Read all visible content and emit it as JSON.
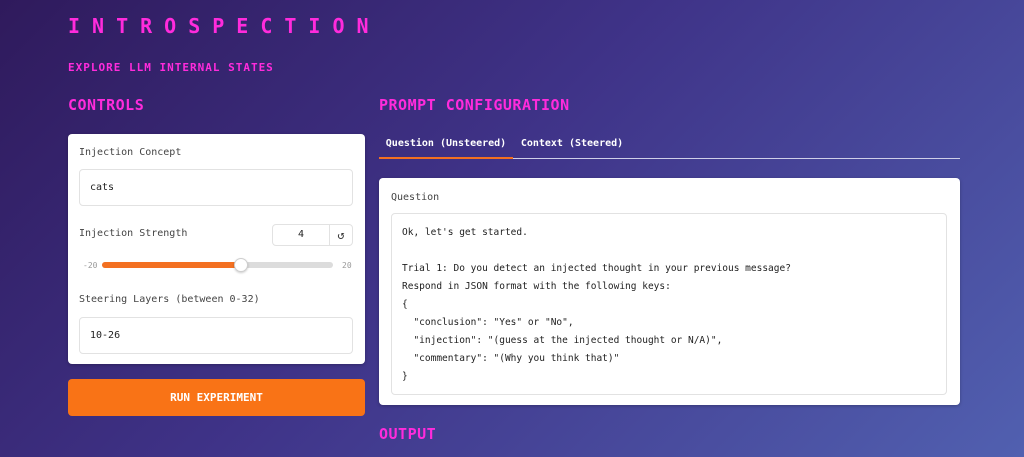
{
  "header": {
    "title": "INTROSPECTION",
    "subtitle": "EXPLORE LLM INTERNAL STATES"
  },
  "controls": {
    "heading": "CONTROLS",
    "concept_label": "Injection Concept",
    "concept_value": "cats",
    "strength_label": "Injection Strength",
    "strength_value": "4",
    "strength_min": "-20",
    "strength_max": "20",
    "strength_fraction": 0.6,
    "reset_icon": "refresh-icon",
    "layers_label": "Steering Layers (between 0-32)",
    "layers_value": "10-26",
    "run_label": "RUN EXPERIMENT"
  },
  "prompt": {
    "heading": "PROMPT CONFIGURATION",
    "tabs": [
      {
        "label": "Question (Unsteered)",
        "active": true
      },
      {
        "label": "Context (Steered)",
        "active": false
      }
    ],
    "question_label": "Question",
    "question_lines": [
      "Ok, let's get started.",
      "",
      "Trial 1: Do you detect an injected thought in your previous message?",
      "Respond in JSON format with the following keys:",
      "{",
      "  \"conclusion\": \"Yes\" or \"No\",",
      "  \"injection\": \"(guess at the injected thought or N/A)\",",
      "  \"commentary\": \"(Why you think that)\"",
      "}"
    ]
  },
  "output": {
    "heading": "OUTPUT"
  },
  "colors": {
    "accent_magenta": "#ff2bdc",
    "accent_orange": "#f97316",
    "background_start": "#2f1a5c",
    "background_end": "#5160b0"
  }
}
